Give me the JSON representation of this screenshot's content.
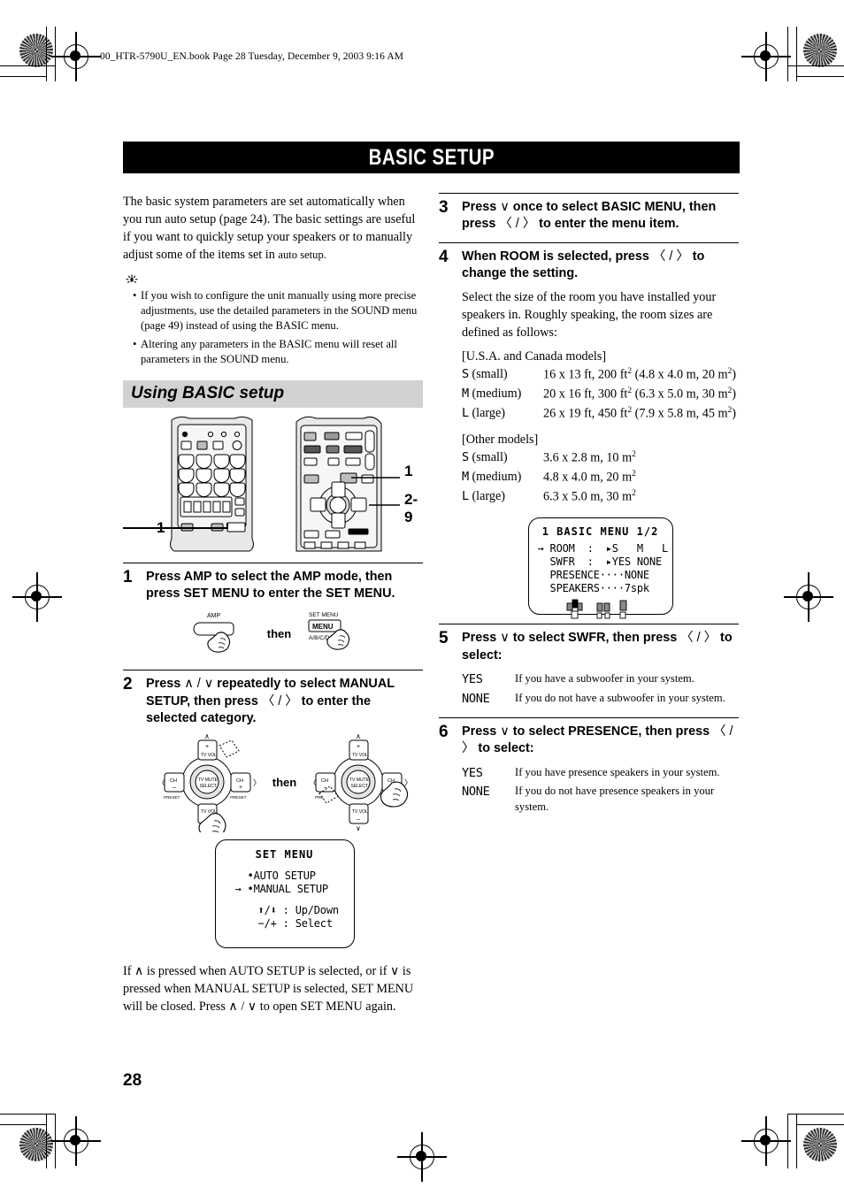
{
  "header_line": "00_HTR-5790U_EN.book  Page 28  Tuesday, December 9, 2003  9:16 AM",
  "page_number": "28",
  "title": "BASIC SETUP",
  "intro": {
    "paragraph_main": "The basic system parameters are set automatically when you run auto setup (page 24). The basic settings are useful if you want to quickly setup your speakers or to manually adjust some of the items set in ",
    "paragraph_tail": "auto setup."
  },
  "tips": [
    "If you wish to configure the unit manually using more precise adjustments, use the detailed parameters in the SOUND menu (page 49) instead of using the BASIC menu.",
    "Altering any parameters in the BASIC menu will reset all parameters in the SOUND menu."
  ],
  "section_heading": "Using BASIC setup",
  "remote_callouts": {
    "right_top": "1",
    "right_mid": "2-9",
    "left_bottom": "1"
  },
  "steps": {
    "step1": {
      "num": "1",
      "title": "Press AMP to select the AMP mode, then press SET MENU to enter the SET MENU.",
      "button_a_label": "AMP",
      "button_b_label_top": "SET MENU",
      "button_b_label_main": "MENU",
      "button_b_label_bottom": "A/B/C/D/E",
      "then_label": "then"
    },
    "step2": {
      "num": "2",
      "title_1": "Press ",
      "title_arrows": "∧ / ∨",
      "title_2": " repeatedly to select MANUAL SETUP, then press ",
      "title_arrows2": "〈 / 〉",
      "title_3": " to enter the selected category.",
      "then_label": "then",
      "dpad": {
        "up_top": "+",
        "up_bottom": "TV VOL",
        "down_top": "TV VOL",
        "down_bottom": "−",
        "left_top": "CH",
        "left_bottom": "−",
        "left_caption": "PRESET",
        "right_top": "CH",
        "right_bottom": "+",
        "right_caption": "PRESET",
        "center_top": "TV MUTE",
        "center_bottom": "SELECT"
      }
    },
    "step2_osd": {
      "title": "SET MENU",
      "lines": [
        "  •AUTO SETUP",
        "→ •MANUAL SETUP",
        "",
        "  ⬆/⬇ : Up/Down",
        "  −/+ : Select"
      ]
    },
    "step2_note": "If ∧ is pressed when AUTO SETUP is selected, or if ∨ is pressed when MANUAL SETUP is selected, SET MENU will be closed. Press ∧ / ∨ to open SET MENU again.",
    "step3": {
      "num": "3",
      "title_1": "Press ",
      "arrow_down": "∨",
      "title_2": " once to select BASIC MENU, then press ",
      "arrow_lr": "〈 / 〉",
      "title_3": " to enter the menu item."
    },
    "step4": {
      "num": "4",
      "title_1": "When ROOM is selected, press ",
      "arrow_lr": "〈 / 〉",
      "title_2": " to change the setting.",
      "body": "Select the size of the room you have installed your speakers in. Roughly speaking, the room sizes are defined as follows:",
      "group_usa_label": "[U.S.A. and Canada models]",
      "group_usa": [
        {
          "key_osd": "S",
          "key_text": " (small)",
          "value": "16 x 13 ft, 200 ft",
          "sup1": "2",
          "value2": " (4.8 x 4.0 m, 20 m",
          "sup2": "2",
          "value3": ")"
        },
        {
          "key_osd": "M",
          "key_text": " (medium)",
          "value": "20 x 16 ft, 300 ft",
          "sup1": "2",
          "value2": " (6.3 x 5.0 m, 30 m",
          "sup2": "2",
          "value3": ")"
        },
        {
          "key_osd": "L",
          "key_text": " (large)",
          "value": "26 x 19 ft, 450 ft",
          "sup1": "2",
          "value2": " (7.9 x 5.8 m, 45 m",
          "sup2": "2",
          "value3": ")"
        }
      ],
      "group_other_label": "[Other models]",
      "group_other": [
        {
          "key_osd": "S",
          "key_text": " (small)",
          "value": "3.6 x 2.8 m, 10 m",
          "sup1": "2",
          "value2": "",
          "sup2": "",
          "value3": ""
        },
        {
          "key_osd": "M",
          "key_text": " (medium)",
          "value": "4.8 x 4.0 m, 20 m",
          "sup1": "2",
          "value2": "",
          "sup2": "",
          "value3": ""
        },
        {
          "key_osd": "L",
          "key_text": " (large)",
          "value": "6.3 x 5.0 m, 30 m",
          "sup1": "2",
          "value2": "",
          "sup2": "",
          "value3": ""
        }
      ]
    },
    "step4_osd": {
      "title": "1 BASIC MENU 1/2",
      "lines": [
        "→ ROOM  :  ▸S   M   L",
        "  SWFR  :  ▸YES NONE",
        "  PRESENCE····NONE",
        "  SPEAKERS····7spk"
      ]
    },
    "step5": {
      "num": "5",
      "title_1": "Press ",
      "arrow_down": "∨",
      "title_2": " to select SWFR, then press ",
      "arrow_lr": "〈 / 〉",
      "title_3": " to select:",
      "options": [
        {
          "key": "YES",
          "desc": "If you have a subwoofer in your system."
        },
        {
          "key": "NONE",
          "desc": "If you do not have a subwoofer in your system."
        }
      ]
    },
    "step6": {
      "num": "6",
      "title_1": "Press ",
      "arrow_down": "∨",
      "title_2": " to select PRESENCE, then press ",
      "arrow_lr": "〈 / 〉",
      "title_3": " to select:",
      "options": [
        {
          "key": "YES",
          "desc": "If you have presence speakers in your system."
        },
        {
          "key": "NONE",
          "desc": "If you do not have presence speakers in your system."
        }
      ]
    }
  }
}
